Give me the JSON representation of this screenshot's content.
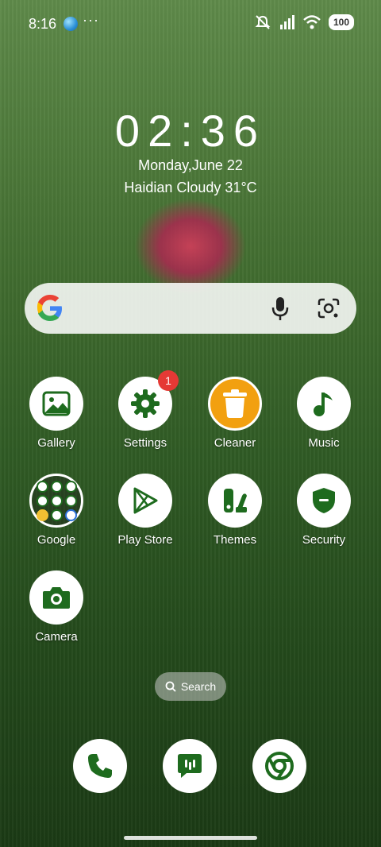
{
  "status_bar": {
    "time": "8:16",
    "more": "···",
    "battery": "100"
  },
  "clock": {
    "time": "02:36",
    "date": "Monday,June 22",
    "weather": "Haidian Cloudy 31°C"
  },
  "apps": [
    {
      "label": "Gallery",
      "icon": "gallery-icon"
    },
    {
      "label": "Settings",
      "icon": "settings-icon",
      "badge": "1"
    },
    {
      "label": "Cleaner",
      "icon": "trash-icon"
    },
    {
      "label": "Music",
      "icon": "music-icon"
    },
    {
      "label": "Google",
      "icon": "google-folder-icon"
    },
    {
      "label": "Play Store",
      "icon": "play-store-icon"
    },
    {
      "label": "Themes",
      "icon": "themes-icon"
    },
    {
      "label": "Security",
      "icon": "security-icon"
    },
    {
      "label": "Camera",
      "icon": "camera-icon"
    }
  ],
  "home_search": {
    "label": "Search"
  },
  "dock": [
    {
      "icon": "phone-icon"
    },
    {
      "icon": "messages-icon"
    },
    {
      "icon": "chrome-icon"
    }
  ],
  "colors": {
    "icon_green": "#1e6b1e",
    "badge_red": "#e53935",
    "cleaner_orange": "#f2a010"
  }
}
